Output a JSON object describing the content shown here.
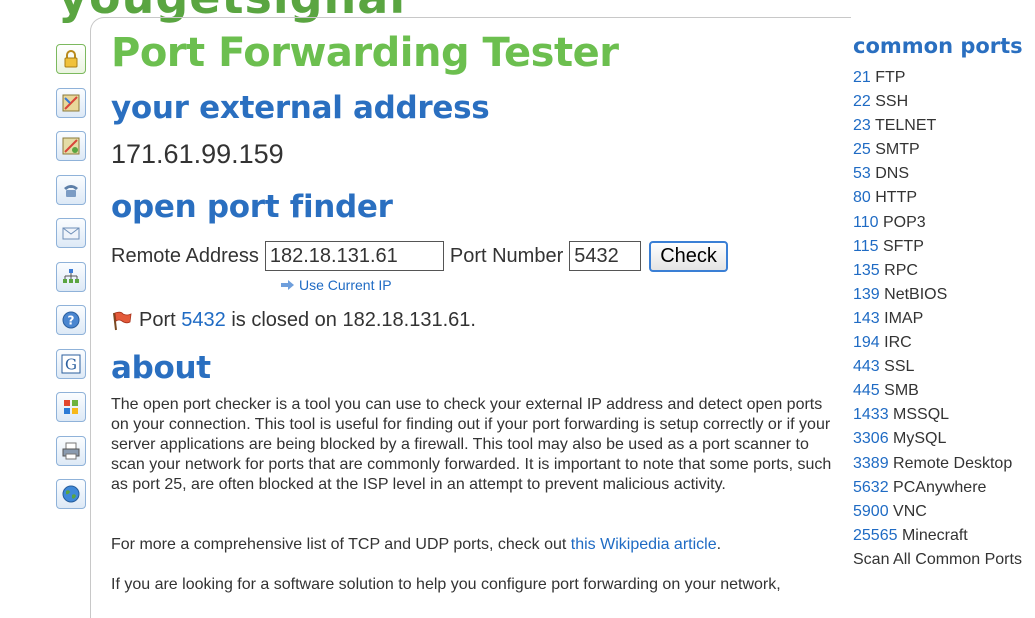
{
  "logo": {
    "text": "yougetsignal"
  },
  "nav_icons": [
    {
      "name": "lock-icon",
      "active": true
    },
    {
      "name": "map-icon",
      "active": false
    },
    {
      "name": "map-route-icon",
      "active": false
    },
    {
      "name": "phone-icon",
      "active": false
    },
    {
      "name": "mail-icon",
      "active": false
    },
    {
      "name": "network-icon",
      "active": false
    },
    {
      "name": "help-icon",
      "active": false
    },
    {
      "name": "google-icon",
      "active": false
    },
    {
      "name": "windows-icon",
      "active": false
    },
    {
      "name": "printer-icon",
      "active": false
    },
    {
      "name": "globe-icon",
      "active": false
    }
  ],
  "main": {
    "title": "Port Forwarding Tester",
    "external_heading": "your external address",
    "external_ip": "171.61.99.159",
    "finder_heading": "open port finder",
    "remote_label": "Remote Address",
    "remote_value": "182.18.131.61",
    "port_label": "Port Number",
    "port_value": "5432",
    "check_label": "Check",
    "use_current_ip": "Use Current IP",
    "result": {
      "prefix": "Port",
      "port": "5432",
      "suffix": "is closed on 182.18.131.61."
    },
    "about_heading": "about",
    "about_text": "The open port checker is a tool you can use to check your external IP address and detect open ports on your connection. This tool is useful for finding out if your port forwarding is setup correctly or if your server applications are being blocked by a firewall. This tool may also be used as a port scanner to scan your network for ports that are commonly forwarded. It is important to note that some ports, such as port 25, are often blocked at the ISP level in an attempt to prevent malicious activity.",
    "tcp_text_pre": "For more a comprehensive list of TCP and UDP ports, check out",
    "tcp_link": "this Wikipedia article",
    "tcp_text_post": ".",
    "software_text": "If you are looking for a software solution to help you configure port forwarding on your network,"
  },
  "sidebar": {
    "title": "common ports",
    "ports": [
      {
        "num": "21",
        "name": "FTP"
      },
      {
        "num": "22",
        "name": "SSH"
      },
      {
        "num": "23",
        "name": "TELNET"
      },
      {
        "num": "25",
        "name": "SMTP"
      },
      {
        "num": "53",
        "name": "DNS"
      },
      {
        "num": "80",
        "name": "HTTP"
      },
      {
        "num": "110",
        "name": "POP3"
      },
      {
        "num": "115",
        "name": "SFTP"
      },
      {
        "num": "135",
        "name": "RPC"
      },
      {
        "num": "139",
        "name": "NetBIOS"
      },
      {
        "num": "143",
        "name": "IMAP"
      },
      {
        "num": "194",
        "name": "IRC"
      },
      {
        "num": "443",
        "name": "SSL"
      },
      {
        "num": "445",
        "name": "SMB"
      },
      {
        "num": "1433",
        "name": "MSSQL"
      },
      {
        "num": "3306",
        "name": "MySQL"
      },
      {
        "num": "3389",
        "name": "Remote Desktop"
      },
      {
        "num": "5632",
        "name": "PCAnywhere"
      },
      {
        "num": "5900",
        "name": "VNC"
      },
      {
        "num": "25565",
        "name": "Minecraft"
      }
    ],
    "scan_all": "Scan All Common Ports"
  },
  "colors": {
    "title_green": "#6cbf4f",
    "heading_blue": "#2a6fc0",
    "link_blue": "#1f6bc4"
  }
}
